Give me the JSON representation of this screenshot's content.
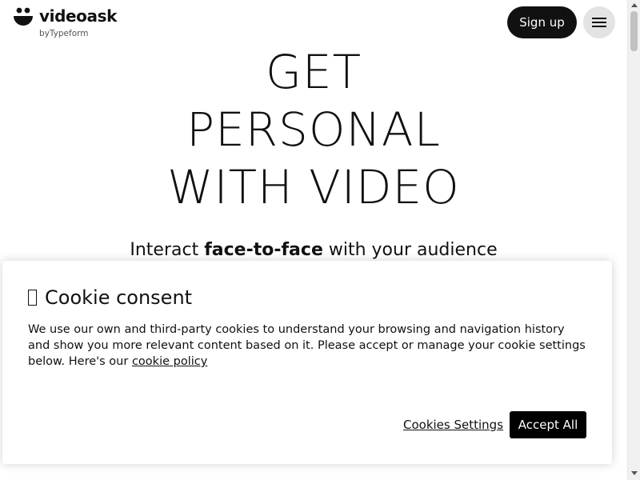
{
  "header": {
    "logo_text": "videoask",
    "logo_sub": "byTypeform",
    "signup_label": "Sign up"
  },
  "hero": {
    "title_lines": [
      "GET",
      "PERSONAL",
      "WITH VIDEO"
    ],
    "subtitle_pre": "Interact ",
    "subtitle_bold": "face-to-face",
    "subtitle_post": " with your audience"
  },
  "cookie": {
    "title": "Cookie consent",
    "body": "We use our own and third-party cookies to understand your browsing and navigation history and show you more relevant content based on it. Please accept or manage your cookie settings below. Here's our ",
    "link": "cookie policy",
    "settings_label": "Cookies Settings",
    "accept_label": "Accept All"
  },
  "icons": {
    "logo": "videoask-smile-logo",
    "menu": "hamburger-menu-icon",
    "cookie_title": "missing-glyph-box"
  },
  "colors": {
    "primary_dark": "#111111",
    "menu_bg": "#e3e3e3",
    "accept_bg": "#000000"
  }
}
